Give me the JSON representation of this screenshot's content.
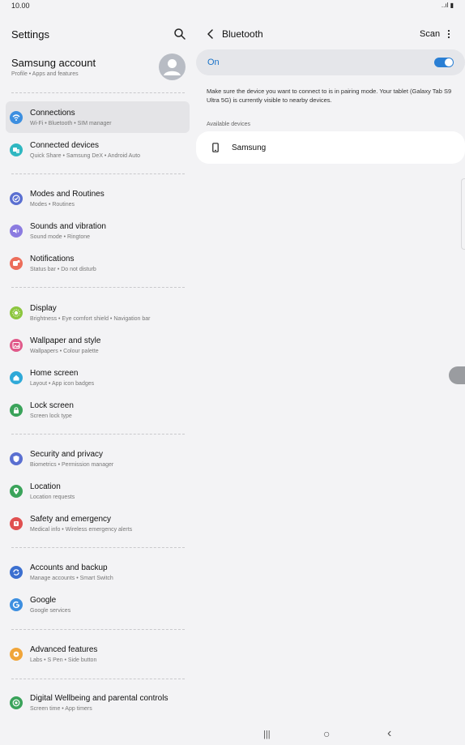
{
  "status": {
    "time": "10.00",
    "signal": "..ıl",
    "battery": "▮"
  },
  "settings": {
    "title": "Settings",
    "account": {
      "name": "Samsung account",
      "sub": "Profile  •  Apps and features"
    },
    "items": [
      {
        "label": "Connections",
        "sub": "Wi-Fi  •  Bluetooth  •  SIM manager",
        "color": "#3d8fe0",
        "icon": "wifi-icon"
      },
      {
        "label": "Connected devices",
        "sub": "Quick Share  •  Samsung DeX  •  Android Auto",
        "color": "#2fb7c1",
        "icon": "devices-icon"
      },
      {
        "label": "Modes and Routines",
        "sub": "Modes  •  Routines",
        "color": "#5a6fd1",
        "icon": "check-circle-icon"
      },
      {
        "label": "Sounds and vibration",
        "sub": "Sound mode  •  Ringtone",
        "color": "#8b7be0",
        "icon": "volume-icon"
      },
      {
        "label": "Notifications",
        "sub": "Status bar  •  Do not disturb",
        "color": "#ec6d5a",
        "icon": "bell-icon"
      },
      {
        "label": "Display",
        "sub": "Brightness  •  Eye comfort shield  •  Navigation bar",
        "color": "#8cc63f",
        "icon": "sun-icon"
      },
      {
        "label": "Wallpaper and style",
        "sub": "Wallpapers  •  Colour palette",
        "color": "#e05a8a",
        "icon": "image-icon"
      },
      {
        "label": "Home screen",
        "sub": "Layout  •  App icon badges",
        "color": "#2fa9d8",
        "icon": "home-icon"
      },
      {
        "label": "Lock screen",
        "sub": "Screen lock type",
        "color": "#3aa35a",
        "icon": "lock-icon"
      },
      {
        "label": "Security and privacy",
        "sub": "Biometrics  •  Permission manager",
        "color": "#5a6fd1",
        "icon": "shield-icon"
      },
      {
        "label": "Location",
        "sub": "Location requests",
        "color": "#3aa35a",
        "icon": "location-icon"
      },
      {
        "label": "Safety and emergency",
        "sub": "Medical info  •  Wireless emergency alerts",
        "color": "#e05050",
        "icon": "alert-icon"
      },
      {
        "label": "Accounts and backup",
        "sub": "Manage accounts  •  Smart Switch",
        "color": "#3b6fd0",
        "icon": "sync-icon"
      },
      {
        "label": "Google",
        "sub": "Google services",
        "color": "#3d8fe0",
        "icon": "google-icon"
      },
      {
        "label": "Advanced features",
        "sub": "Labs  •  S Pen  •  Side button",
        "color": "#f0a53a",
        "icon": "star-gear-icon"
      },
      {
        "label": "Digital Wellbeing and parental controls",
        "sub": "Screen time  •  App timers",
        "color": "#3aa35a",
        "icon": "wellbeing-icon"
      }
    ]
  },
  "bluetooth": {
    "title": "Bluetooth",
    "scan_label": "Scan",
    "on_label": "On",
    "toggle_on": true,
    "info": "Make sure the device you want to connect to is in pairing mode. Your tablet (Galaxy Tab S9 Ultra 5G) is currently visible to nearby devices.",
    "available_header": "Available devices",
    "devices": [
      {
        "name": "Samsung"
      }
    ]
  },
  "nav": {
    "recents": "|||",
    "home": "○",
    "back": "‹"
  }
}
